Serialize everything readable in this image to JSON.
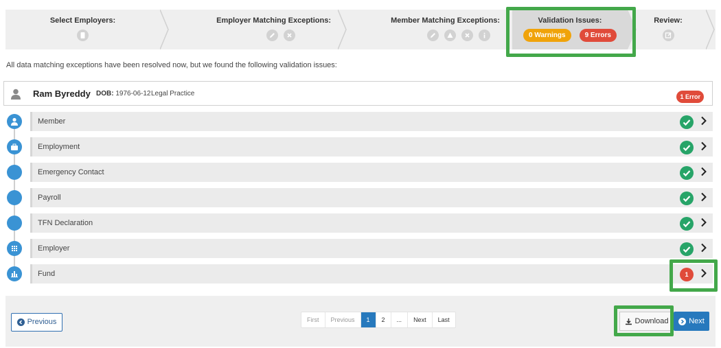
{
  "stepper": {
    "steps": [
      {
        "title": "Select Employers:"
      },
      {
        "title": "Employer Matching Exceptions:"
      },
      {
        "title": "Member Matching Exceptions:"
      },
      {
        "title": "Validation Issues:",
        "warnings": "0 Warnings",
        "errors": "9 Errors"
      },
      {
        "title": "Review:"
      }
    ]
  },
  "info_message": "All data matching exceptions have been resolved now, but we found the following validation issues:",
  "member": {
    "name": "Ram Byreddy",
    "dob_label": "DOB:",
    "dob": "1976-06-12",
    "practice": "Legal Practice",
    "error_badge": "1 Error"
  },
  "sections": [
    {
      "label": "Member",
      "status": "ok"
    },
    {
      "label": "Employment",
      "status": "ok"
    },
    {
      "label": "Emergency Contact",
      "status": "ok"
    },
    {
      "label": "Payroll",
      "status": "ok"
    },
    {
      "label": "TFN Declaration",
      "status": "ok"
    },
    {
      "label": "Employer",
      "status": "ok"
    },
    {
      "label": "Fund",
      "status": "error",
      "count": "1"
    }
  ],
  "footer": {
    "previous": "Previous",
    "download": "Download",
    "next": "Next",
    "pagination": {
      "first": "First",
      "previous": "Previous",
      "page1": "1",
      "page2": "2",
      "ellipsis": "...",
      "next": "Next",
      "last": "Last"
    }
  },
  "colors": {
    "accent": "#2779bd",
    "success": "#27a468",
    "danger": "#e04b3a",
    "warning": "#f0a30a",
    "highlight": "#43a84a"
  }
}
